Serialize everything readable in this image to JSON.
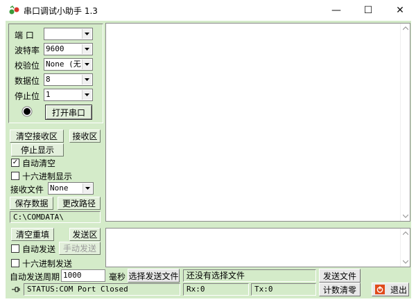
{
  "window": {
    "title": "串口调试小助手 1.3",
    "minimize": "—",
    "maximize": "☐",
    "close": "✕"
  },
  "settings": {
    "port_label": "端  口",
    "port_value": "",
    "baud_label": "波特率",
    "baud_value": "9600",
    "parity_label": "校验位",
    "parity_value": "None (无)",
    "databits_label": "数据位",
    "databits_value": "8",
    "stopbits_label": "停止位",
    "stopbits_value": "1",
    "open_port": "打开串口"
  },
  "receive": {
    "clear_button": "清空接收区",
    "area_label": "接收区",
    "stop_display": "停止显示",
    "auto_clear_label": "自动清空",
    "auto_clear_checked": true,
    "hex_display_label": "十六进制显示",
    "hex_display_checked": false,
    "file_label": "接收文件",
    "file_type_value": "None",
    "save_data": "保存数据",
    "change_path": "更改路径",
    "path_value": "C:\\COMDATA\\"
  },
  "send": {
    "clear_button": "清空重填",
    "area_label": "发送区",
    "auto_send_label": "自动发送",
    "auto_send_checked": false,
    "manual_send": "手动发送",
    "hex_send_label": "十六进制发送",
    "hex_send_checked": false,
    "period_label": "自动发送周期",
    "period_value": "1000",
    "ms_label": "毫秒",
    "select_file": "选择发送文件",
    "file_status": "还没有选择文件",
    "send_file": "发送文件"
  },
  "status": {
    "text": "STATUS:COM Port Closed",
    "rx": "Rx:0",
    "tx": "Tx:0",
    "reset_count": "计数清零",
    "exit": "退出"
  },
  "colors": {
    "panel_bg": "#d4ebc9",
    "button_bg": "#e2efdb",
    "indicator": "#000000",
    "exit_icon": "#e04a1a"
  }
}
